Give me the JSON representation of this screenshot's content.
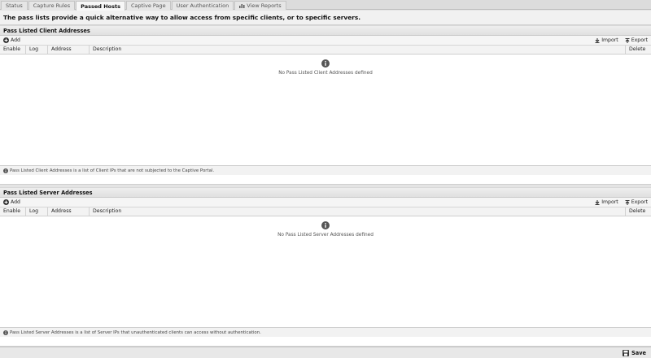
{
  "tabs": [
    {
      "label": "Status",
      "active": false,
      "icon": ""
    },
    {
      "label": "Capture Rules",
      "active": false,
      "icon": ""
    },
    {
      "label": "Passed Hosts",
      "active": true,
      "icon": ""
    },
    {
      "label": "Captive Page",
      "active": false,
      "icon": ""
    },
    {
      "label": "User Authentication",
      "active": false,
      "icon": ""
    },
    {
      "label": "View Reports",
      "active": false,
      "icon": "chart-icon"
    }
  ],
  "info": "The pass lists provide a quick alternative way to allow access from specific clients, or to specific servers.",
  "client_panel": {
    "title": "Pass Listed Client Addresses",
    "add_label": "Add",
    "import_label": "Import",
    "export_label": "Export",
    "columns": [
      "Enable",
      "Log",
      "Address",
      "Description",
      "Delete"
    ],
    "empty_text": "No Pass Listed Client Addresses defined",
    "note": "Pass Listed Client Addresses is a list of Client IPs that are not subjected to the Captive Portal."
  },
  "server_panel": {
    "title": "Pass Listed Server Addresses",
    "add_label": "Add",
    "import_label": "Import",
    "export_label": "Export",
    "columns": [
      "Enable",
      "Log",
      "Address",
      "Description",
      "Delete"
    ],
    "empty_text": "No Pass Listed Server Addresses defined",
    "note": "Pass Listed Server Addresses is a list of Server IPs that unauthenticated clients can access without authentication."
  },
  "save_label": "Save",
  "colors": {
    "accent": "#333333",
    "info_icon": "#555555"
  }
}
